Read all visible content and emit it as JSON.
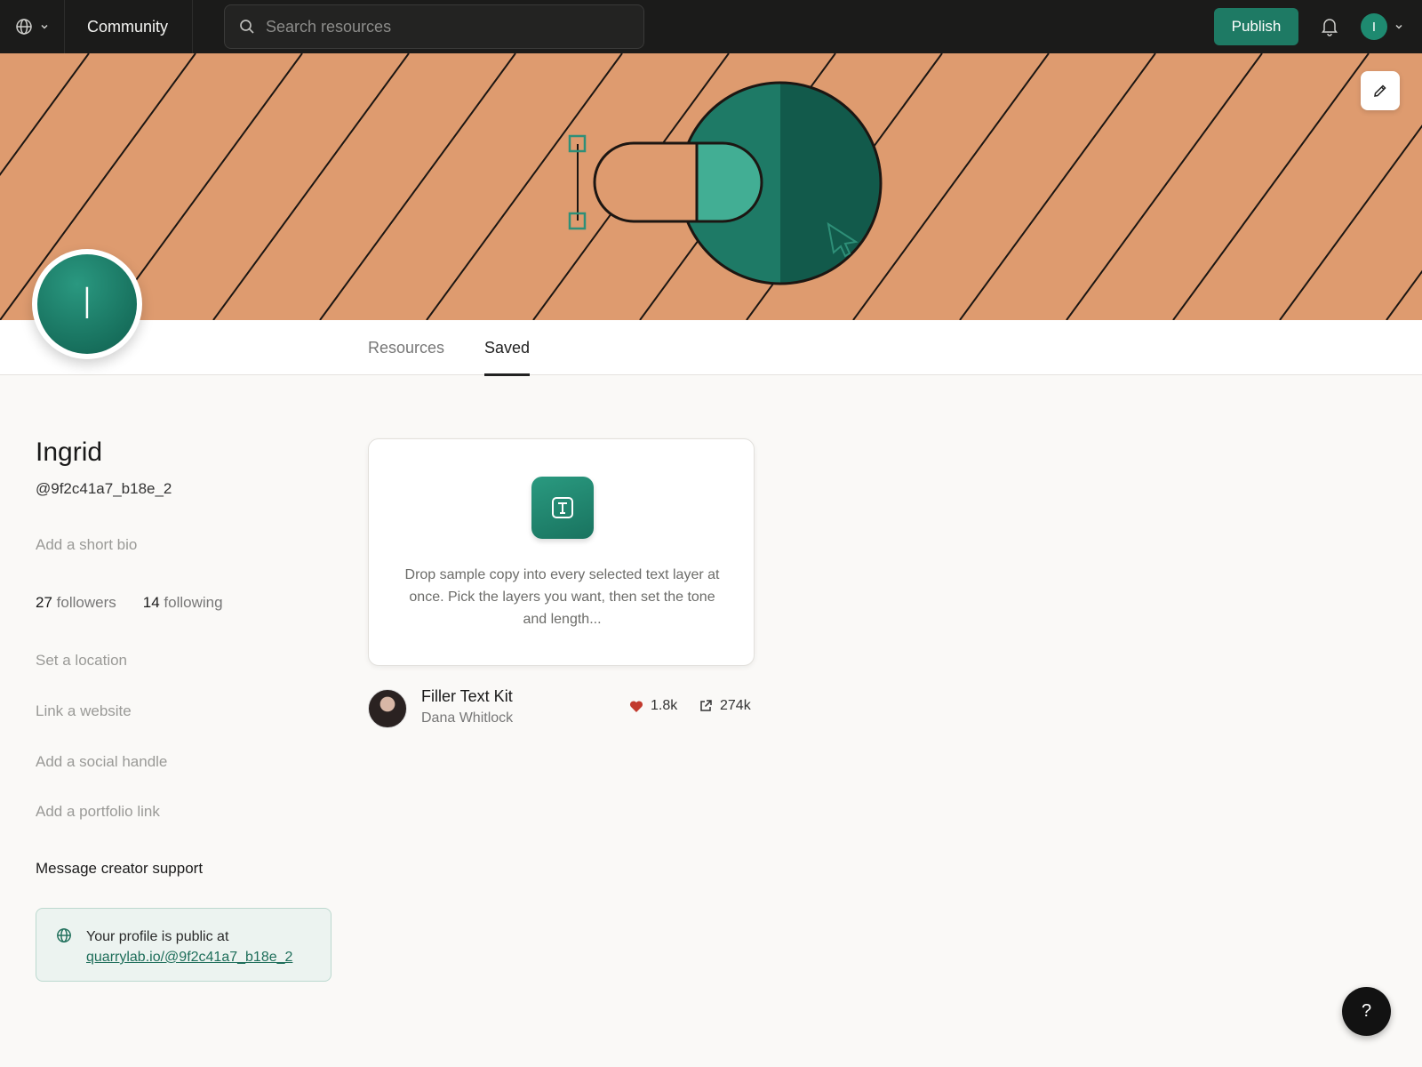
{
  "topbar": {
    "community_label": "Community",
    "search_placeholder": "Search resources",
    "publish_label": "Publish",
    "user_initial": "I",
    "icons": [
      "globe-icon",
      "chevron-down-icon",
      "search-icon",
      "bell-icon"
    ]
  },
  "tabs": [
    {
      "label": "Resources",
      "active": false
    },
    {
      "label": "Saved",
      "active": true
    }
  ],
  "profile": {
    "avatar_initial": "I",
    "name": "Ingrid",
    "handle": "@9f2c41a7_b18e_2",
    "bio_placeholder": "Add a short bio",
    "followers_count": "27",
    "followers_label": "followers",
    "following_count": "14",
    "following_label": "following",
    "location_placeholder": "Set a location",
    "website_placeholder": "Link a website",
    "social_placeholder": "Add a social handle",
    "portfolio_placeholder": "Add a portfolio link",
    "support_link": "Message creator support",
    "public_notice": "Your profile is public at",
    "public_url": "quarrylab.io/@9f2c41a7_b18e_2"
  },
  "resource": {
    "description": "Drop sample copy into every selected text layer at once. Pick the layers you want, then set the tone and length...",
    "title": "Filler Text Kit",
    "author": "Dana Whitlock",
    "likes": "1.8k",
    "uses": "274k"
  },
  "help_label": "?",
  "colors": {
    "brand": "#1e7a64",
    "banner": "#de9b6f",
    "banner_circle_light": "#1e7a66",
    "banner_circle_dark": "#125a4b",
    "banner_pill_accent": "#42ae94",
    "heart": "#c23a2e"
  }
}
